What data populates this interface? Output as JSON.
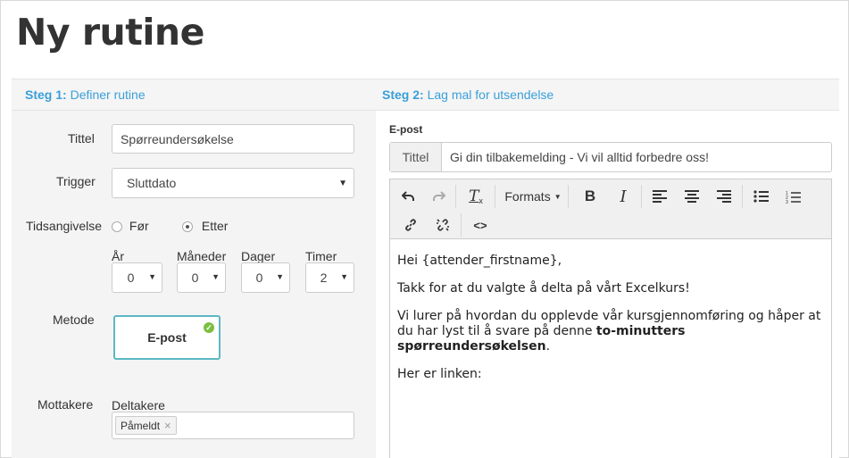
{
  "page": {
    "title": "Ny rutine"
  },
  "steps": {
    "step1": {
      "num": "Steg 1:",
      "label": "Definer rutine"
    },
    "step2": {
      "num": "Steg 2:",
      "label": "Lag mal for utsendelse"
    }
  },
  "form": {
    "title_label": "Tittel",
    "title_value": "Spørreundersøkelse",
    "trigger_label": "Trigger",
    "trigger_value": "Sluttdato",
    "timing_label": "Tidsangivelse",
    "timing_options": [
      "Før",
      "Etter"
    ],
    "timing_selected": "Etter",
    "units": [
      {
        "label": "År",
        "value": "0"
      },
      {
        "label": "Måneder",
        "value": "0"
      },
      {
        "label": "Dager",
        "value": "0"
      },
      {
        "label": "Timer",
        "value": "2"
      }
    ],
    "method_label": "Metode",
    "method_value": "E-post",
    "recipients_label": "Mottakere",
    "recipients_sublabel": "Deltakere",
    "recipients_tags": [
      "Påmeldt"
    ]
  },
  "email": {
    "section_label": "E-post",
    "subject_addon": "Tittel",
    "subject_value": "Gi din tilbakemelding - Vi vil alltid forbedre oss!",
    "toolbar": {
      "formats_label": "Formats"
    },
    "body": {
      "greeting": "Hei {attender_firstname},",
      "line1": "Takk for at du valgte å delta på vårt Excelkurs!",
      "line2_start": "Vi lurer på hvordan du opplevde vår kursgjennomføring og håper at du har lyst til å svare på denne ",
      "line2_bold": "to-minutters spørreundersøkelsen",
      "line2_end": ".",
      "line3": "Her er linken:"
    }
  },
  "colors": {
    "accent": "#3a9fd9",
    "method_border": "#5cb8c4",
    "check": "#7cbf3f"
  }
}
